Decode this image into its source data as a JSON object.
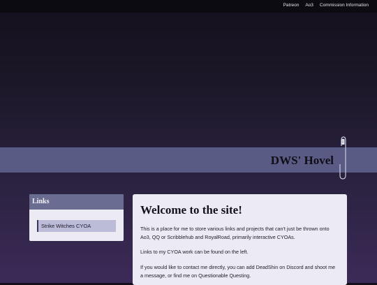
{
  "nav": {
    "links": [
      "Patreon",
      "Ao3",
      "Commission Information"
    ]
  },
  "banner": {
    "title": "DWS' Hovel"
  },
  "sidebar": {
    "heading": "Links",
    "items": [
      {
        "label": "Strike Witches CYOA"
      }
    ]
  },
  "main": {
    "heading": "Welcome to the site!",
    "paragraphs": [
      "This is a place for me to store various links and projects that can't just be thrown onto Ao3, QQ or Scribblehub and RoyalRoad, primarily interactive CYOAs.",
      "Links to my CYOA work can be found on the left.",
      "If you would like to contact me directly, you can add DeadShin on Discord and shoot me a message, or find me on Questionable Questing."
    ]
  },
  "colors": {
    "banner": "#5a5b85",
    "card_header": "#6b6c92",
    "link_item": "#bcbbd8",
    "card_bg": "#eceaf2"
  }
}
